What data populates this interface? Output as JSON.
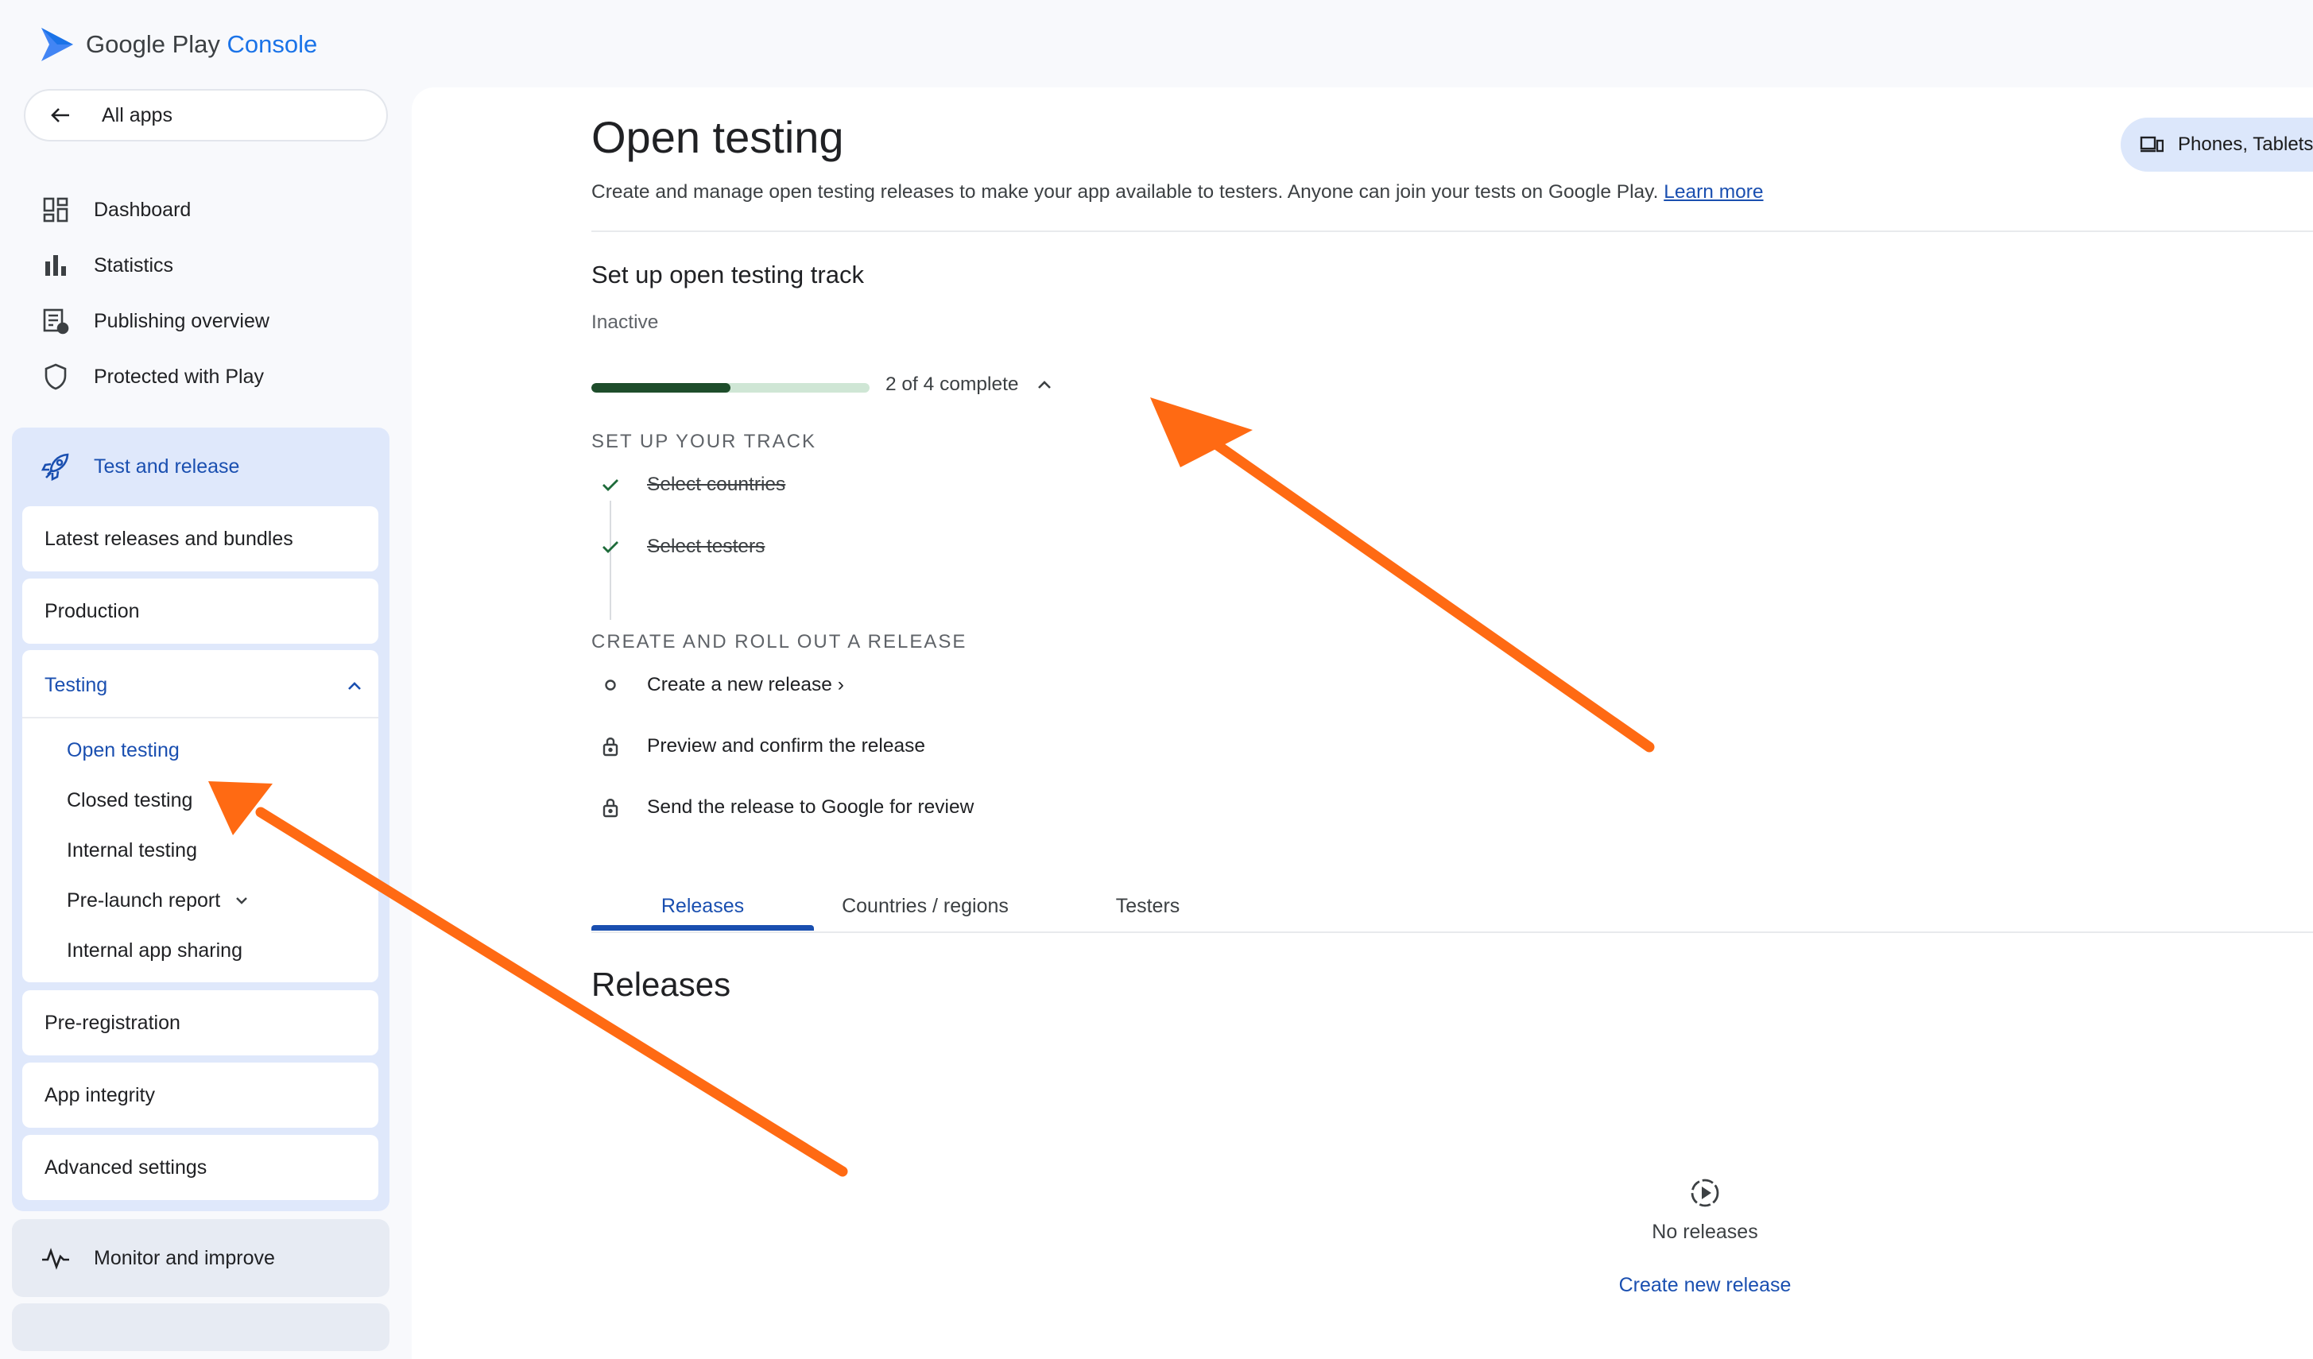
{
  "brand": {
    "name": "Google Play",
    "product": "Console",
    "accent": "#1a73e8"
  },
  "sidebar": {
    "all_apps": "All apps",
    "items": [
      {
        "label": "Dashboard",
        "icon": "dashboard-icon"
      },
      {
        "label": "Statistics",
        "icon": "bar-chart-icon"
      },
      {
        "label": "Publishing overview",
        "icon": "publishing-icon"
      },
      {
        "label": "Protected with Play",
        "icon": "shield-icon"
      }
    ],
    "test_and_release": {
      "label": "Test and release",
      "icon": "rocket-icon",
      "cards": [
        "Latest releases and bundles",
        "Production"
      ],
      "testing": {
        "label": "Testing",
        "items": [
          "Open testing",
          "Closed testing",
          "Internal testing",
          "Pre-launch report",
          "Internal app sharing"
        ],
        "active": "Open testing"
      },
      "cards_after": [
        "Pre-registration",
        "App integrity",
        "Advanced settings"
      ]
    },
    "monitor": {
      "label": "Monitor and improve",
      "icon": "pulse-icon"
    }
  },
  "main": {
    "title": "Open testing",
    "description": "Create and manage open testing releases to make your app available to testers. Anyone can join your tests on Google Play.",
    "learn_more": "Learn more",
    "device_filter": "Phones, Tablets",
    "setup": {
      "title": "Set up open testing track",
      "status": "Inactive",
      "progress": {
        "done": 2,
        "total": 4,
        "label": "2 of 4 complete"
      },
      "group1": {
        "label": "SET UP YOUR TRACK",
        "steps": [
          "Select countries",
          "Select testers"
        ]
      },
      "group2": {
        "label": "CREATE AND ROLL OUT A RELEASE",
        "steps": [
          "Create a new release ›",
          "Preview and confirm the release",
          "Send the release to Google for review"
        ]
      }
    },
    "tabs": [
      "Releases",
      "Countries / regions",
      "Testers"
    ],
    "active_tab": "Releases",
    "releases": {
      "title": "Releases",
      "empty_text": "No releases",
      "create_link": "Create new release"
    }
  },
  "colors": {
    "active_blue": "#1a4fb0",
    "progress_fill": "#1e4d2b",
    "progress_track": "#cfe6d5",
    "annotation_arrow": "#ff6a13",
    "sidebar_group": "#dfe8fb"
  }
}
